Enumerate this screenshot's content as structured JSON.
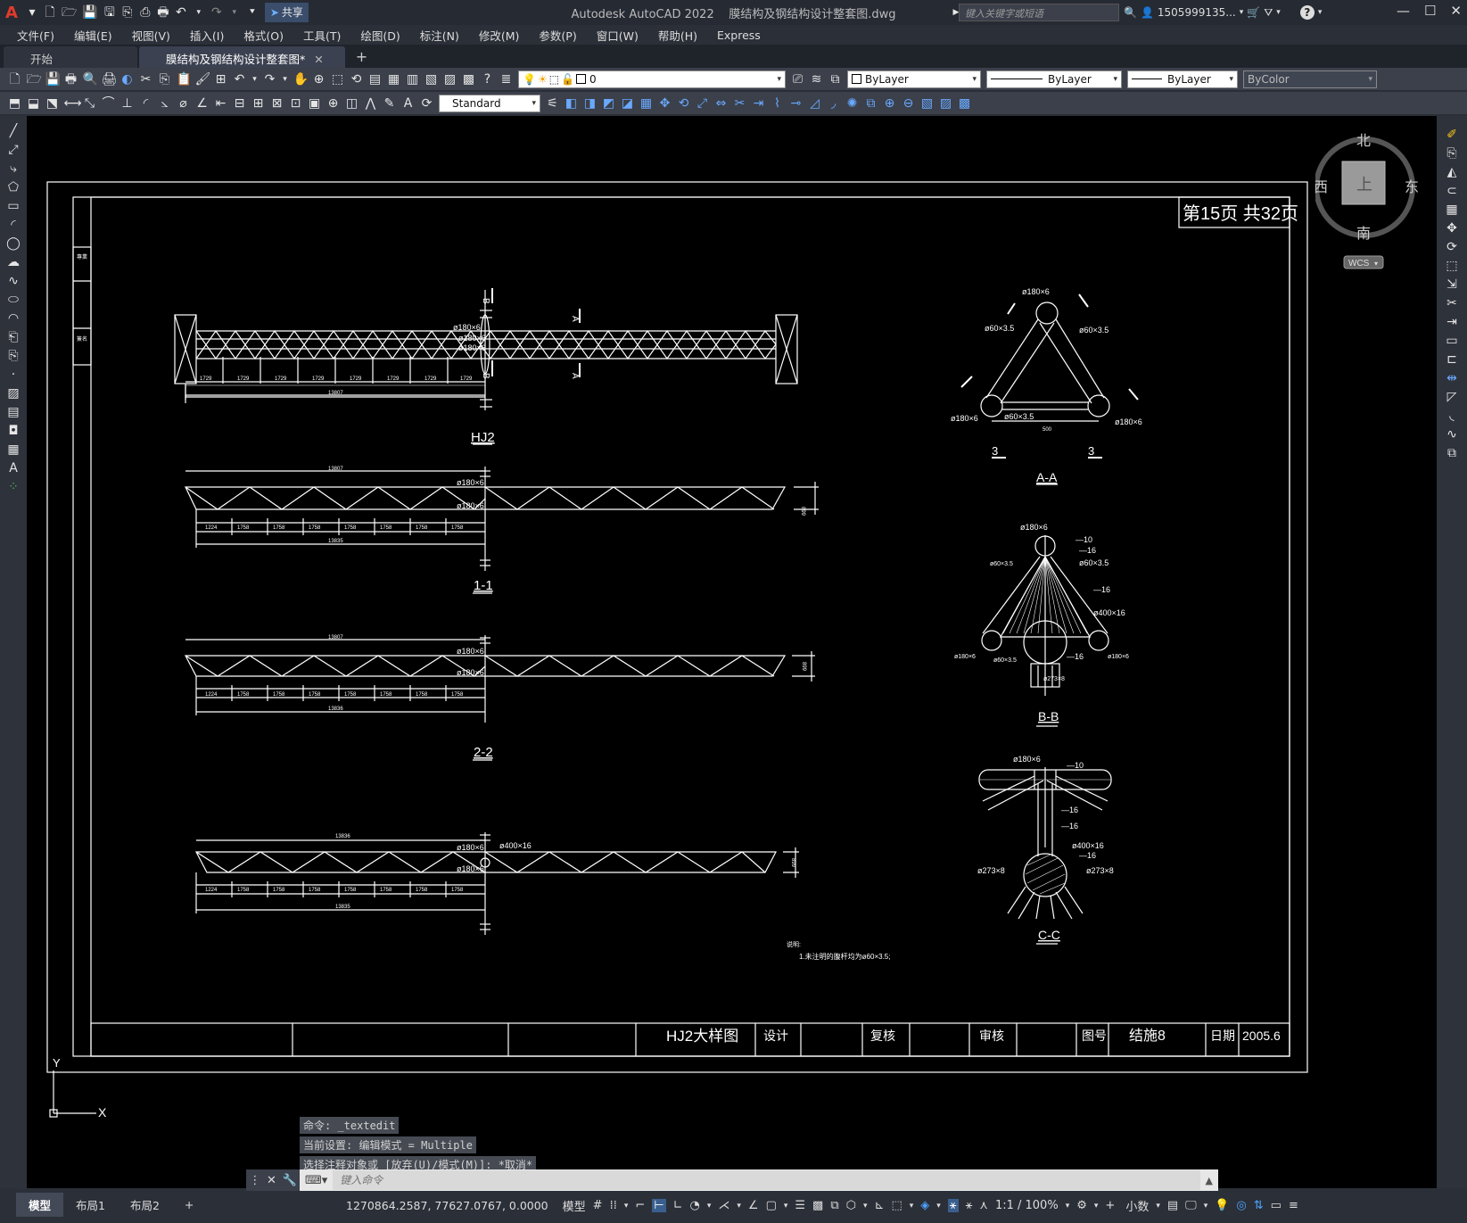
{
  "titlebar": {
    "app_logo": "A",
    "share_label": "共享",
    "app_name": "Autodesk AutoCAD 2022",
    "file_name": "膜结构及钢结构设计整套图.dwg",
    "search_placeholder": "键入关键字或短语",
    "user": "1505999135...",
    "help": "?"
  },
  "menu": [
    "文件(F)",
    "编辑(E)",
    "视图(V)",
    "插入(I)",
    "格式(O)",
    "工具(T)",
    "绘图(D)",
    "标注(N)",
    "修改(M)",
    "参数(P)",
    "窗口(W)",
    "帮助(H)",
    "Express"
  ],
  "tabs": {
    "start": "开始",
    "drawing": "膜结构及钢结构设计整套图*",
    "close": "✕",
    "add": "+"
  },
  "toolbar": {
    "layer_value": "0",
    "color": "ByLayer",
    "linetype": "ByLayer",
    "lineweight": "ByLayer",
    "plotstyle": "ByColor",
    "textstyle": "Standard"
  },
  "viewcube": {
    "north": "北",
    "south": "南",
    "east": "东",
    "west": "西",
    "face": "上",
    "wcs": "WCS"
  },
  "drawing": {
    "page_info": "第15页 共32页",
    "views": {
      "hj2": "HJ2",
      "s11": "1-1",
      "s22": "2-2",
      "aa": "A-A",
      "bb": "B-B",
      "cc": "C-C"
    },
    "marks": {
      "A": "A",
      "B": "B",
      "three": "3"
    },
    "labels": {
      "p180x6": "ø180×6",
      "p60x35": "ø60×3.5",
      "p400x16": "ø400×16",
      "p273x8": "ø273×8",
      "plate10": "—10",
      "plate16": "—16",
      "dim1729": "1729",
      "dim13807": "13807",
      "dim13835": "13835",
      "dim1758": "1758",
      "dim1224": "1224",
      "dim1729b": "1729",
      "dim13836": "13836",
      "dim899": "899",
      "dim500": "500"
    },
    "note_title": "说明:",
    "note_line": "1.未注明的腹杆均为ø60×3.5;",
    "titleblock": {
      "name": "HJ2大样图",
      "design": "设计",
      "review": "复核",
      "approve": "审核",
      "drawing_no_label": "图号",
      "drawing_no": "结施8",
      "date_label": "日期",
      "date": "2005.6"
    },
    "ucs_x": "X",
    "ucs_y": "Y"
  },
  "command": {
    "history": [
      "命令: _textedit",
      "当前设置: 编辑模式 = Multiple",
      "选择注释对象或 [放弃(U)/模式(M)]: *取消*"
    ],
    "placeholder": "键入命令"
  },
  "status": {
    "layouts": [
      "模型",
      "布局1",
      "布局2"
    ],
    "add": "+",
    "coords": "1270864.2587, 77627.0767, 0.0000",
    "model": "模型",
    "scale": "1:1 / 100%",
    "units": "小数"
  }
}
